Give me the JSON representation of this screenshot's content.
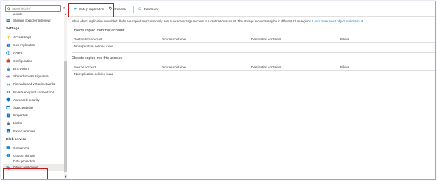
{
  "sidebar": {
    "search_placeholder": "Search (Ctrl+/)",
    "collapse_icon": "chevrons-left-icon",
    "items_top": [
      {
        "label": "events",
        "icon": "none"
      },
      {
        "label": "Storage Explorer (preview)",
        "icon": "storage-explorer-icon"
      }
    ],
    "settings_header": "Settings",
    "settings_items": [
      {
        "label": "Access keys",
        "icon": "key-icon",
        "color": "#f2c811"
      },
      {
        "label": "Geo-replication",
        "icon": "globe-icon",
        "color": "#0078d4"
      },
      {
        "label": "CORS",
        "icon": "cors-icon",
        "color": "#0078d4"
      },
      {
        "label": "Configuration",
        "icon": "briefcase-icon",
        "color": "#c4432c"
      },
      {
        "label": "Encryption",
        "icon": "lock-icon",
        "color": "#0078d4"
      },
      {
        "label": "Shared access signature",
        "icon": "link-icon",
        "color": "#5c2d91"
      },
      {
        "label": "Firewalls and virtual networks",
        "icon": "network-icon",
        "color": "#00a2ad"
      },
      {
        "label": "Private endpoint connections",
        "icon": "endpoint-icon",
        "color": "#00a2ad"
      },
      {
        "label": "Advanced security",
        "icon": "shield-icon",
        "color": "#0078d4"
      },
      {
        "label": "Static website",
        "icon": "website-icon",
        "color": "#0078d4"
      },
      {
        "label": "Properties",
        "icon": "properties-icon",
        "color": "#0078d4"
      },
      {
        "label": "Locks",
        "icon": "lock-icon",
        "color": "#605e5c"
      },
      {
        "label": "Export template",
        "icon": "template-icon",
        "color": "#0078d4"
      }
    ],
    "blob_header": "Blob service",
    "blob_items": [
      {
        "label": "Containers",
        "icon": "container-icon",
        "color": "#0078d4"
      },
      {
        "label": "Custom domain",
        "icon": "globe-icon",
        "color": "#0078d4"
      },
      {
        "label": "Data protection",
        "icon": "shield-icon",
        "color": "#0078d4"
      }
    ],
    "selected_item": {
      "label": "Object replication",
      "icon": "object-replication-icon",
      "color": "#0078d4"
    }
  },
  "toolbar": {
    "setup_label": "Set up replication",
    "refresh_label": "Refresh",
    "feedback_label": "Feedback"
  },
  "info": {
    "text": "When object replication is enabled, blobs are copied asynchronously from a source storage account to a destination account. The storage accounts may be in different Azure regions.",
    "link": "Learn more about object replication"
  },
  "copied_from": {
    "title": "Objects copied from this account",
    "columns": [
      "Destination account",
      "Source container",
      "Destination container",
      "Filters"
    ],
    "empty_message": "No replication policies found"
  },
  "copied_into": {
    "title": "Objects copied into this account",
    "columns": [
      "Source account",
      "Source container",
      "Destination container",
      "Filters"
    ],
    "empty_message": "No replication policies found"
  },
  "highlight_color": "#c4171d",
  "accent_color": "#0078d4"
}
